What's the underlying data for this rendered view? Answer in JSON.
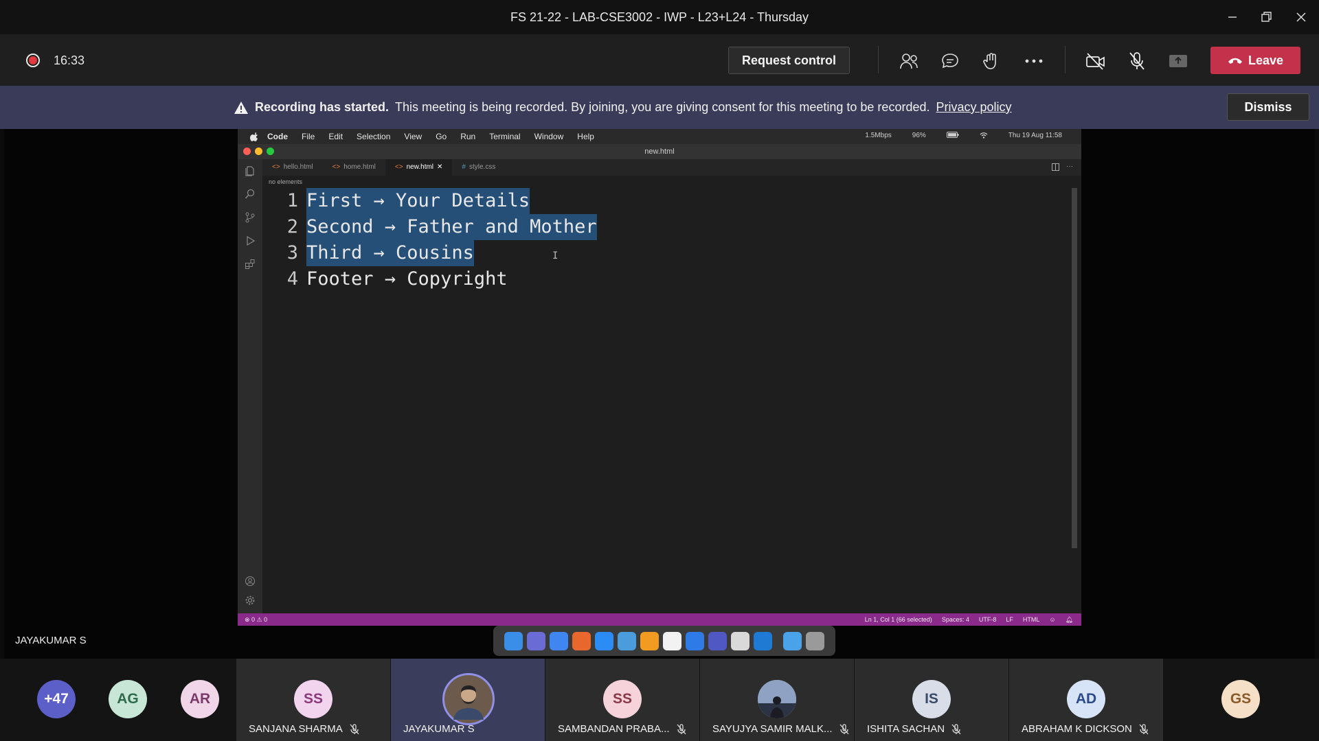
{
  "window": {
    "title": "FS 21-22 - LAB-CSE3002 - IWP - L23+L24 - Thursday"
  },
  "toolbar": {
    "timer": "16:33",
    "request_control": "Request control",
    "leave": "Leave"
  },
  "banner": {
    "heading": "Recording has started.",
    "text": "This meeting is being recorded. By joining, you are giving consent for this meeting to be recorded.",
    "link": "Privacy policy",
    "dismiss": "Dismiss"
  },
  "mac": {
    "menu": [
      "Code",
      "File",
      "Edit",
      "Selection",
      "View",
      "Go",
      "Run",
      "Terminal",
      "Window",
      "Help"
    ],
    "status_right": [
      "1.5Mbps",
      "96%",
      "Thu 19 Aug 11:58"
    ],
    "window_title": "new.html"
  },
  "editor": {
    "tabs": [
      "hello.html",
      "home.html",
      "new.html",
      "style.css"
    ],
    "breadcrumb": "no elements",
    "lines": [
      {
        "num": "1",
        "text": "First → Your Details"
      },
      {
        "num": "2",
        "text": "Second → Father and Mother"
      },
      {
        "num": "3",
        "text": "Third → Cousins"
      },
      {
        "num": "4",
        "text": "Footer → Copyright"
      }
    ],
    "status_left": "⊗ 0 ⚠ 0",
    "status_right": [
      "Ln 1, Col 1 (66 selected)",
      "Spaces: 4",
      "UTF-8",
      "LF",
      "HTML"
    ]
  },
  "presenter": "JAYAKUMAR S",
  "participants": {
    "overflow": "+47",
    "small": [
      {
        "initials": "AG",
        "color": "#c8e6d6"
      },
      {
        "initials": "AR",
        "color": "#f0d6e8"
      }
    ],
    "tiles": [
      {
        "initials": "SS",
        "name": "SANJANA SHARMA",
        "color": "#f3d4ee"
      },
      {
        "initials": "",
        "name": "JAYAKUMAR S",
        "color": "#c9a889"
      },
      {
        "initials": "SS",
        "name": "SAMBANDAN PRABA...",
        "color": "#f6d2da"
      },
      {
        "initials": "",
        "name": "SAYUJYA SAMIR MALK...",
        "color": "#9aa8c0"
      },
      {
        "initials": "IS",
        "name": "ISHITA SACHAN",
        "color": "#d8dde8"
      },
      {
        "initials": "AD",
        "name": "ABRAHAM K DICKSON",
        "color": "#d7e3f6"
      }
    ],
    "last": {
      "initials": "GS",
      "color": "#f6dfc7"
    }
  }
}
